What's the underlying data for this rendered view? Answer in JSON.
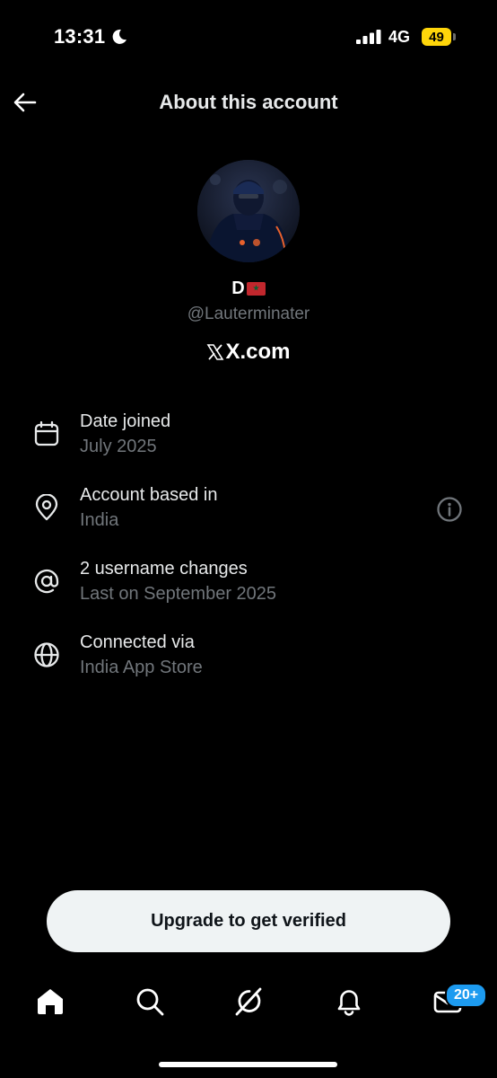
{
  "status_bar": {
    "time": "13:31",
    "network": "4G",
    "battery": "49",
    "icons": [
      "moon-icon",
      "signal-icon",
      "battery-icon"
    ],
    "battery_color": "#ffd60a"
  },
  "header": {
    "title": "About this account",
    "back_icon": "arrow-left-icon"
  },
  "profile": {
    "display_name": "D",
    "flag_icon": "morocco-flag-icon",
    "handle": "@Lauterminater",
    "domain": "X.com"
  },
  "info_rows": [
    {
      "icon": "calendar-icon",
      "title": "Date joined",
      "subtitle": "July 2025"
    },
    {
      "icon": "location-pin-icon",
      "title": "Account based in",
      "subtitle": "India",
      "action_icon": "info-icon"
    },
    {
      "icon": "at-sign-icon",
      "title": "2 username changes",
      "subtitle": "Last on September 2025"
    },
    {
      "icon": "globe-icon",
      "title": "Connected via",
      "subtitle": "India App Store"
    }
  ],
  "upgrade_button": {
    "label": "Upgrade to get verified"
  },
  "tab_bar": {
    "items": [
      "home-icon",
      "search-icon",
      "grok-icon",
      "bell-icon",
      "mail-icon"
    ],
    "mail_badge": "20+",
    "badge_color": "#1d9bf0"
  },
  "colors": {
    "background": "#000000",
    "primary_text": "#e7e9ea",
    "secondary_text": "#71767b",
    "button_bg": "#eff3f4"
  }
}
